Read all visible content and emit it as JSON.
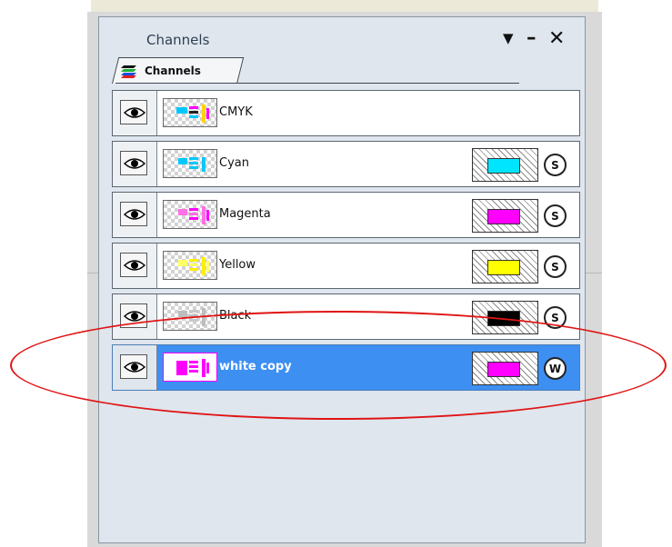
{
  "panel": {
    "title": "Channels",
    "tab_label": "Channels",
    "icons": {
      "menu": "dropdown-arrow-icon",
      "minimize": "minimize-icon",
      "close": "close-icon",
      "tab": "channels-stack-icon",
      "visibility": "eye-icon"
    }
  },
  "channels": [
    {
      "label": "CMYK",
      "swatch_color": null,
      "mode": null,
      "selected": false
    },
    {
      "label": "Cyan",
      "swatch_color": "#00e5ff",
      "mode": "S",
      "selected": false
    },
    {
      "label": "Magenta",
      "swatch_color": "#ff00ff",
      "mode": "S",
      "selected": false
    },
    {
      "label": "Yellow",
      "swatch_color": "#ffff00",
      "mode": "S",
      "selected": false
    },
    {
      "label": "Black",
      "swatch_color": "#000000",
      "mode": "S",
      "selected": false
    },
    {
      "label": "white copy",
      "swatch_color": "#ff00ff",
      "mode": "W",
      "selected": true
    }
  ],
  "colors": {
    "selection": "#3d8ff2",
    "annotation": "#e01414",
    "panel_bg": "#dfe6ee"
  }
}
